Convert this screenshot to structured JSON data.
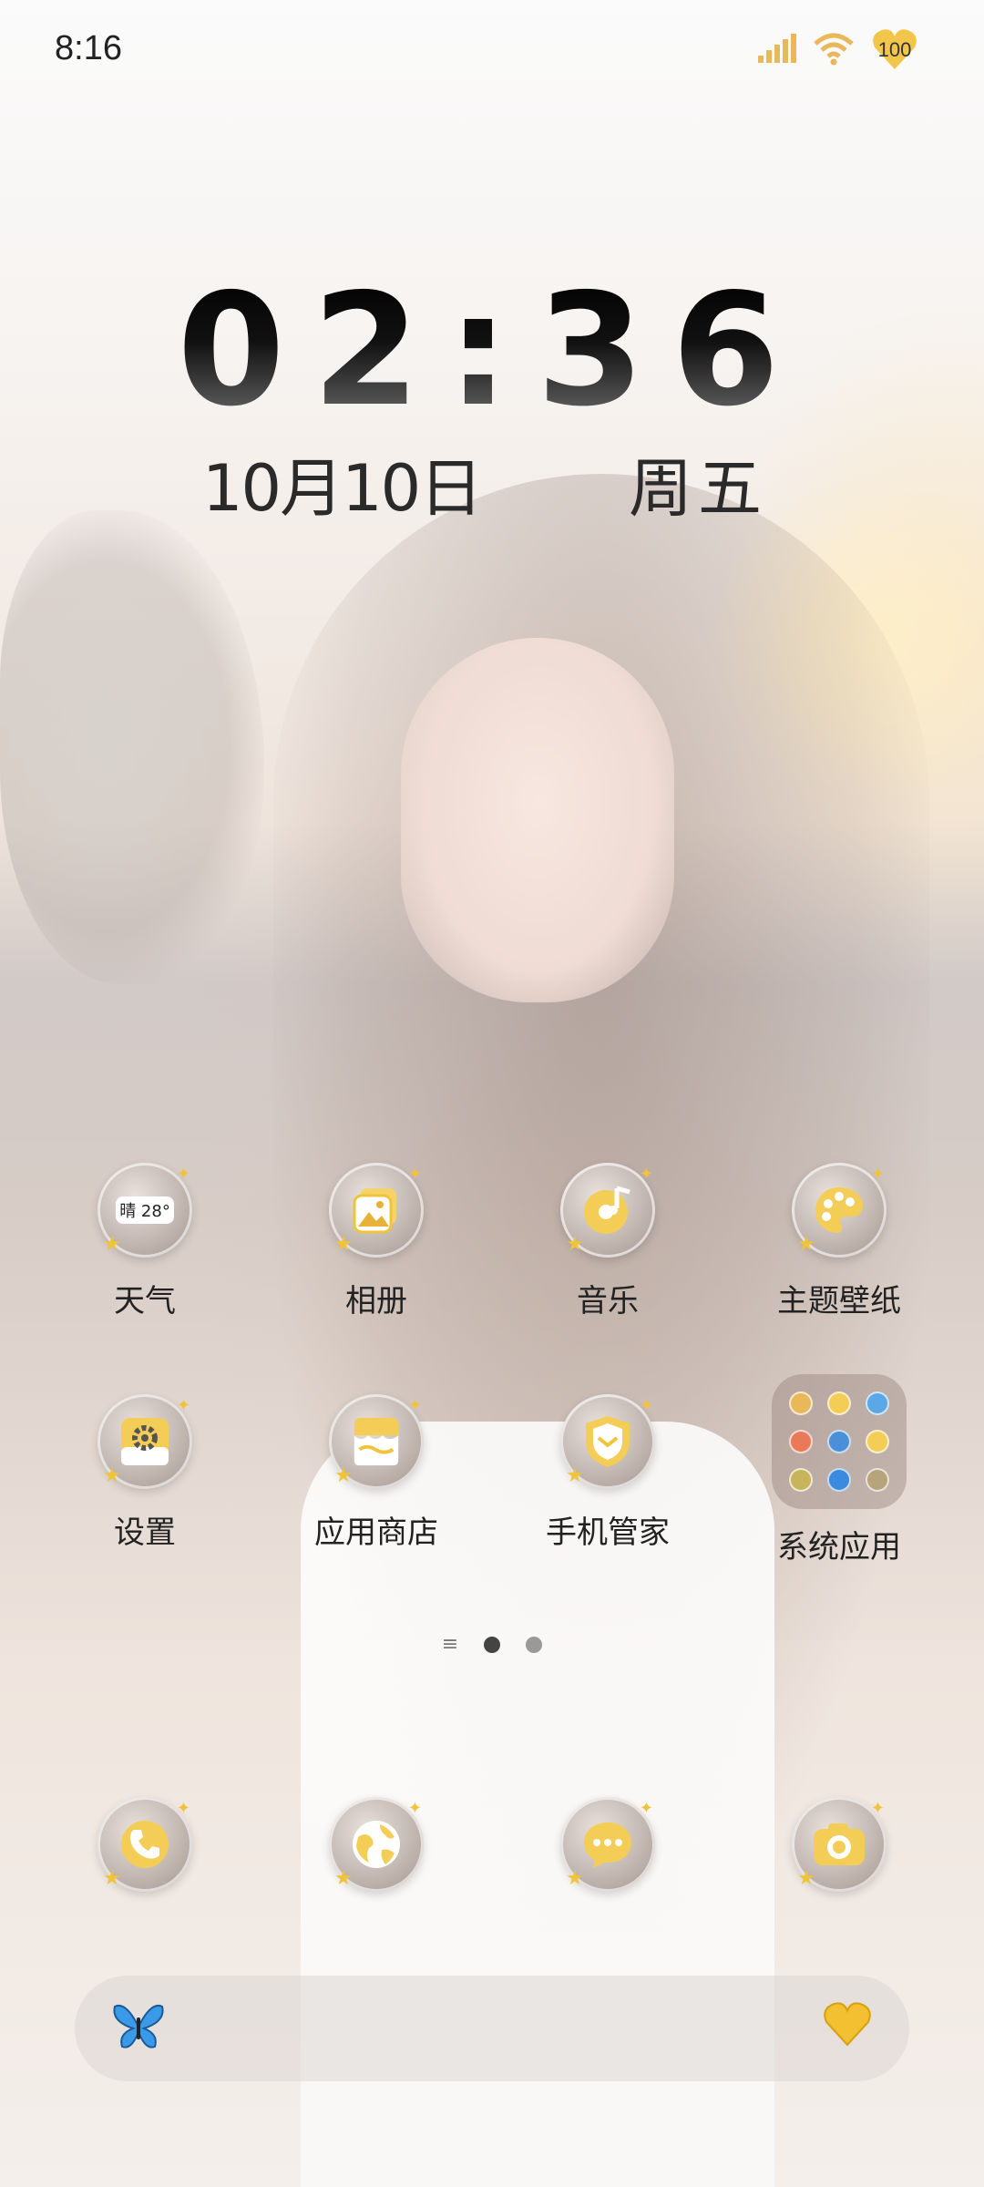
{
  "status_bar": {
    "time": "8:16",
    "battery": "100",
    "icons": [
      "signal-icon",
      "wifi-icon",
      "heart-battery-icon"
    ]
  },
  "clock_widget": {
    "time": "02:36",
    "date": "10月10日",
    "weekday": "周五"
  },
  "apps": [
    {
      "label": "天气",
      "icon": "weather-icon",
      "badge": "晴 28°"
    },
    {
      "label": "相册",
      "icon": "gallery-icon"
    },
    {
      "label": "音乐",
      "icon": "music-icon"
    },
    {
      "label": "主题壁纸",
      "icon": "palette-icon"
    },
    {
      "label": "设置",
      "icon": "gear-icon"
    },
    {
      "label": "应用商店",
      "icon": "app-store-icon"
    },
    {
      "label": "手机管家",
      "icon": "shield-icon"
    },
    {
      "label": "系统应用",
      "icon": "folder-icon"
    }
  ],
  "pager": {
    "pages": 2,
    "current": 0
  },
  "dock": [
    {
      "icon": "phone-icon"
    },
    {
      "icon": "browser-icon"
    },
    {
      "icon": "message-icon"
    },
    {
      "icon": "camera-icon"
    }
  ],
  "search_bar": {
    "left_icon": "butterfly-icon",
    "right_icon": "heart-icon"
  },
  "colors": {
    "icon_accent": "#f0c43a",
    "text": "#222222"
  }
}
